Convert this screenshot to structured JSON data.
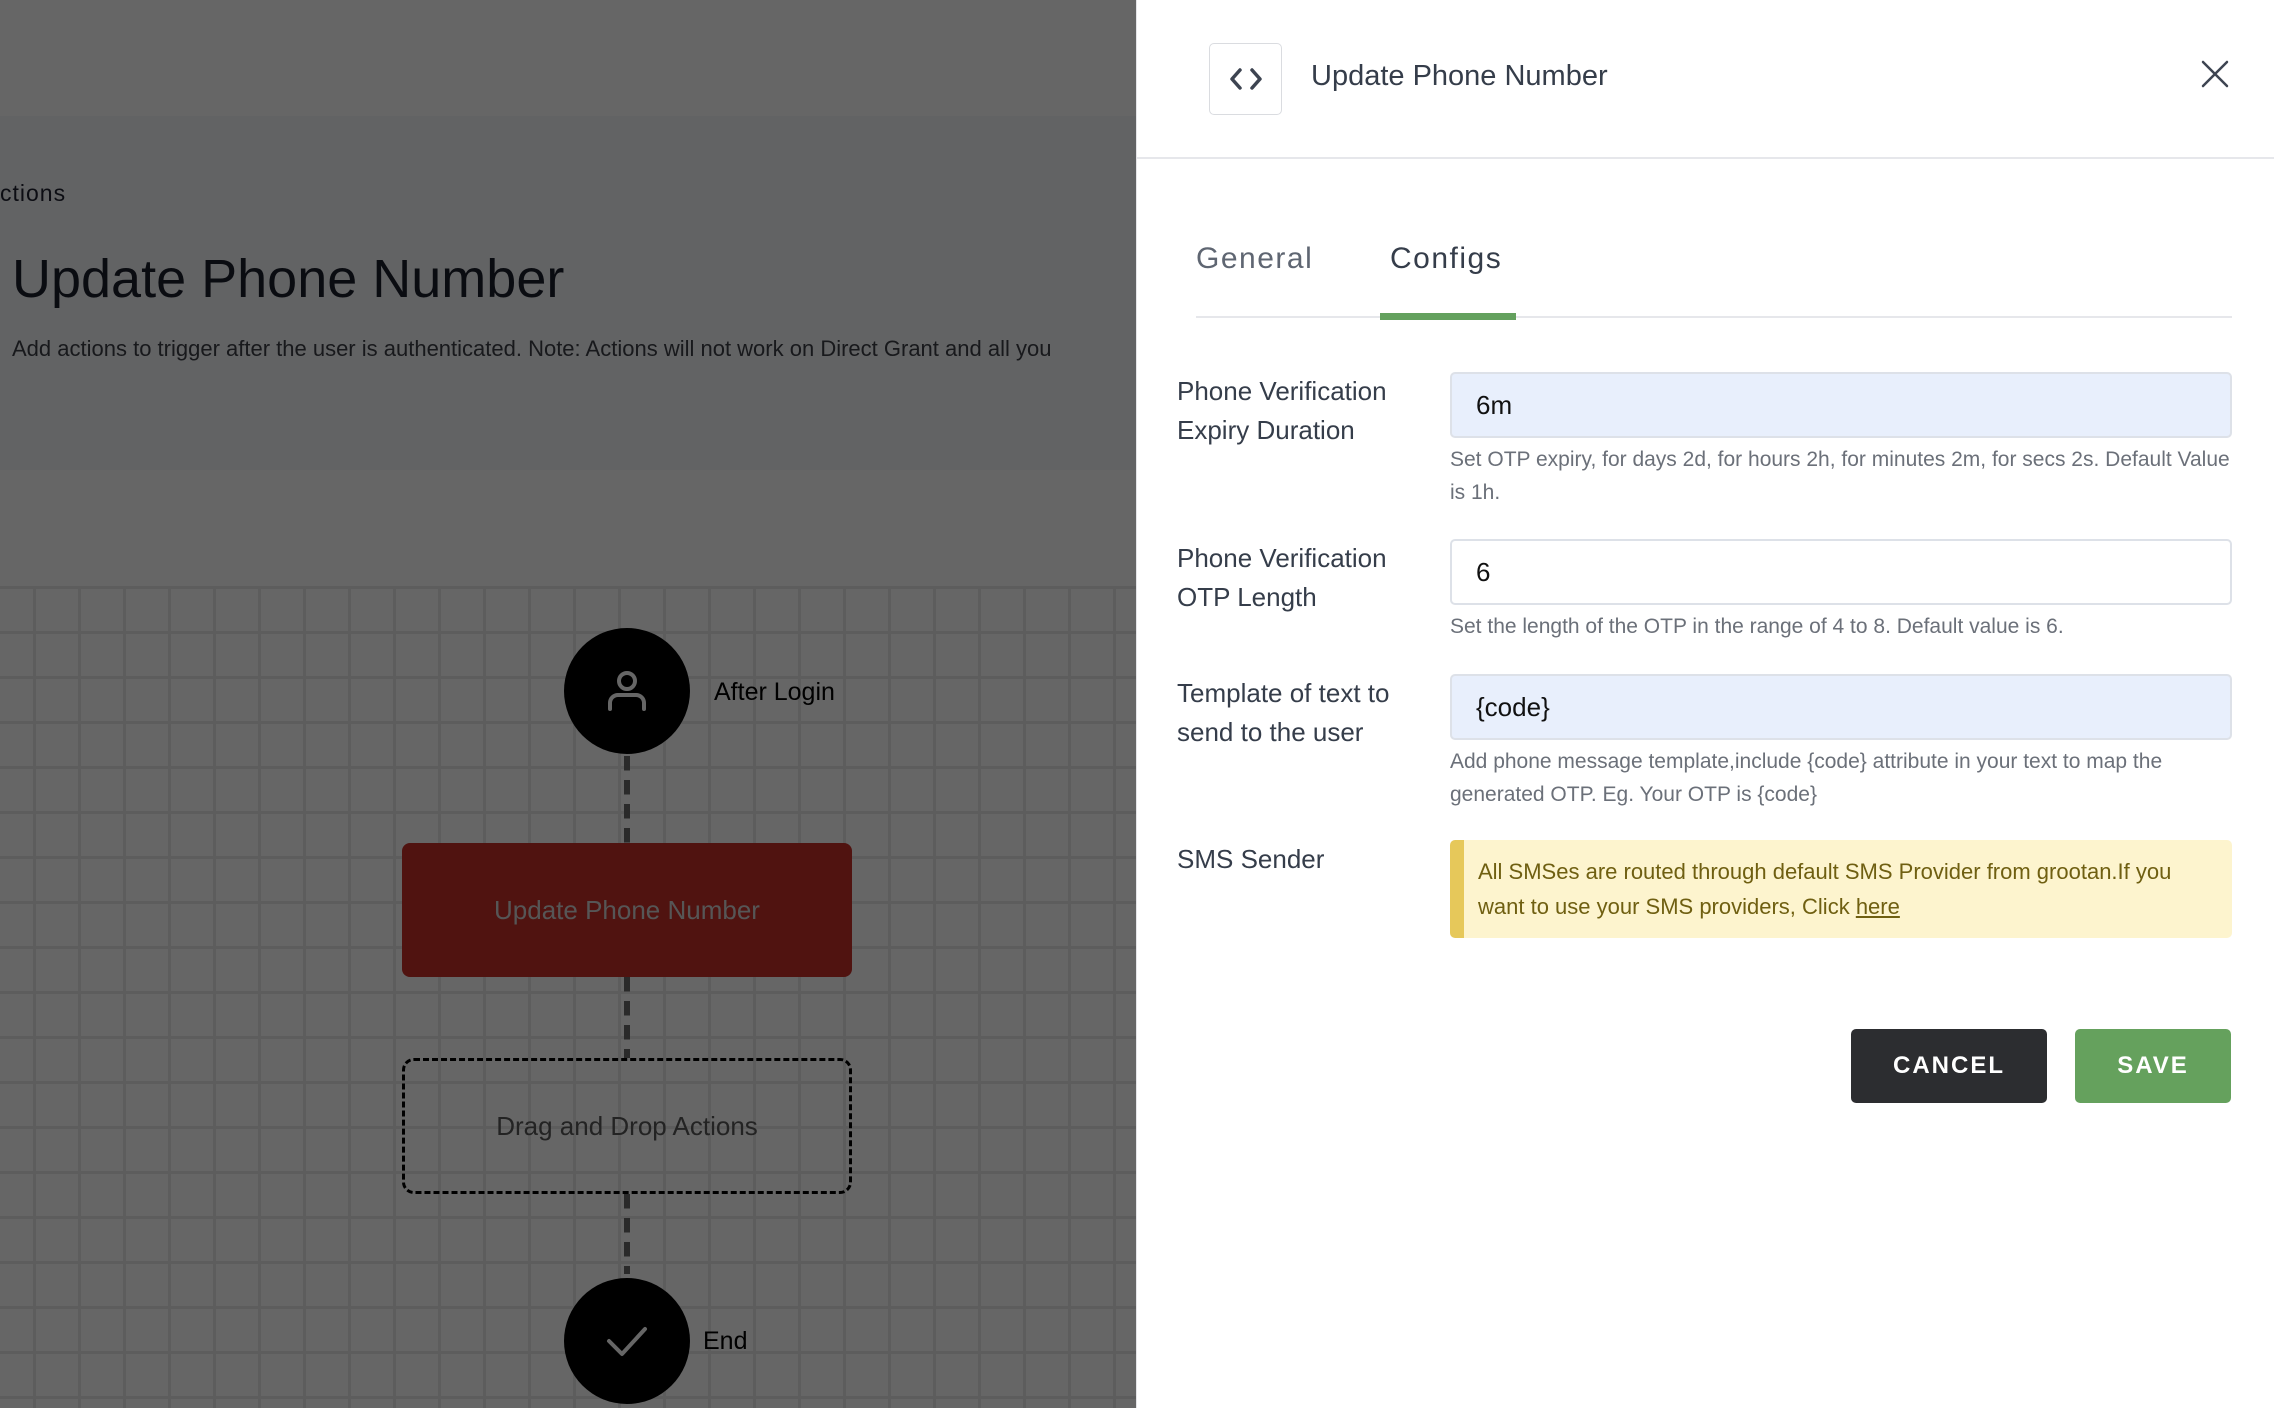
{
  "background": {
    "breadcrumb": "ctions",
    "page_title": "Update Phone Number",
    "page_description": "Add actions to trigger after the user is authenticated. Note: Actions will not work on Direct Grant and all you",
    "flow": {
      "start_node": {
        "label": "After Login",
        "icon": "user-icon"
      },
      "action_node": {
        "label": "Update Phone Number",
        "color": "#c7312a"
      },
      "drop_zone": {
        "label": "Drag and Drop Actions"
      },
      "end_node": {
        "label": "End",
        "icon": "check-icon"
      }
    }
  },
  "drawer": {
    "header": {
      "icon": "code-icon",
      "title": "Update Phone Number",
      "close_icon": "close-icon"
    },
    "tabs": [
      {
        "label": "General",
        "active": false
      },
      {
        "label": "Configs",
        "active": true
      }
    ],
    "fields": [
      {
        "label": "Phone Verification Expiry Duration",
        "value": "6m",
        "help": "Set OTP expiry, for days 2d, for hours 2h, for minutes 2m, for secs 2s. Default Value is 1h."
      },
      {
        "label": "Phone Verification OTP Length",
        "value": "6",
        "help": "Set the length of the OTP in the range of 4 to 8. Default value is 6."
      },
      {
        "label": "Template of text to send to the user",
        "value": "{code}",
        "help": "Add phone message template,include {code} attribute in your text to map the generated OTP. Eg. Your OTP is {code}"
      }
    ],
    "sms_sender": {
      "label": "SMS Sender",
      "alert_text": "All SMSes are routed through default SMS Provider from grootan.If you want to use your SMS providers, Click ",
      "link_text": "here"
    },
    "buttons": {
      "cancel": "CANCEL",
      "save": "SAVE"
    },
    "colors": {
      "accent": "#65a15d",
      "tab_underline": "#64a15e",
      "alert_bg": "#fdf4ce",
      "alert_border": "#e6c85a",
      "cancel_bg": "#2c2d30"
    }
  }
}
